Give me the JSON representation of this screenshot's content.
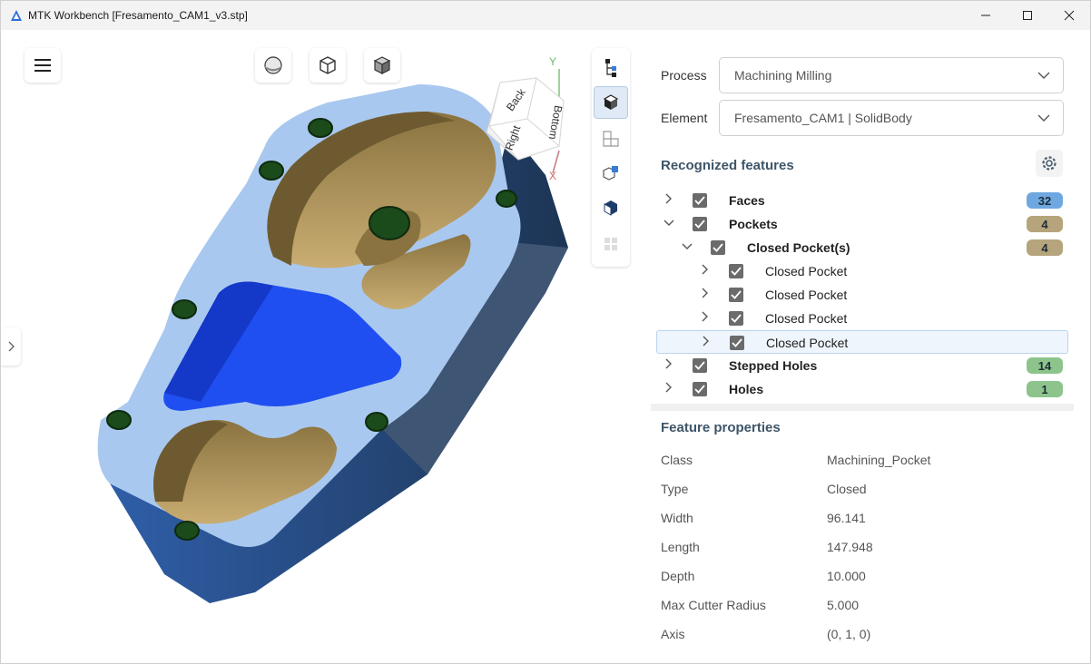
{
  "window": {
    "title": "MTK Workbench [Fresamento_CAM1_v3.stp]"
  },
  "viewport": {
    "cube_faces": [
      "Back",
      "Bottom",
      "Right"
    ],
    "axis_labels": {
      "y": "Y",
      "x": "X"
    }
  },
  "panel": {
    "process_label": "Process",
    "process_value": "Machining Milling",
    "element_label": "Element",
    "element_value": "Fresamento_CAM1 | SolidBody",
    "recognized_title": "Recognized features",
    "tree": [
      {
        "label": "Faces",
        "bold": true,
        "level": 0,
        "expanded": false,
        "badge": "32",
        "badge_color": "#6fa8e0"
      },
      {
        "label": "Pockets",
        "bold": true,
        "level": 0,
        "expanded": true,
        "badge": "4",
        "badge_color": "#b5a47c"
      },
      {
        "label": "Closed Pocket(s)",
        "bold": true,
        "level": 1,
        "expanded": true,
        "badge": "4",
        "badge_color": "#b5a47c"
      },
      {
        "label": "Closed Pocket",
        "bold": false,
        "level": 2,
        "expanded": false,
        "badge": ""
      },
      {
        "label": "Closed Pocket",
        "bold": false,
        "level": 2,
        "expanded": false,
        "badge": ""
      },
      {
        "label": "Closed Pocket",
        "bold": false,
        "level": 2,
        "expanded": false,
        "badge": ""
      },
      {
        "label": "Closed Pocket",
        "bold": false,
        "level": 2,
        "expanded": false,
        "badge": "",
        "selected": true
      },
      {
        "label": "Stepped Holes",
        "bold": true,
        "level": 0,
        "expanded": false,
        "badge": "14",
        "badge_color": "#8cc48c"
      },
      {
        "label": "Holes",
        "bold": true,
        "level": 0,
        "expanded": false,
        "badge": "1",
        "badge_color": "#8cc48c"
      }
    ],
    "properties_title": "Feature properties",
    "properties": [
      {
        "name": "Class",
        "value": "Machining_Pocket"
      },
      {
        "name": "Type",
        "value": "Closed"
      },
      {
        "name": "Width",
        "value": "96.141"
      },
      {
        "name": "Length",
        "value": "147.948"
      },
      {
        "name": "Depth",
        "value": "10.000"
      },
      {
        "name": "Max Cutter Radius",
        "value": "5.000"
      },
      {
        "name": "Axis",
        "value": "(0, 1, 0)"
      }
    ]
  }
}
